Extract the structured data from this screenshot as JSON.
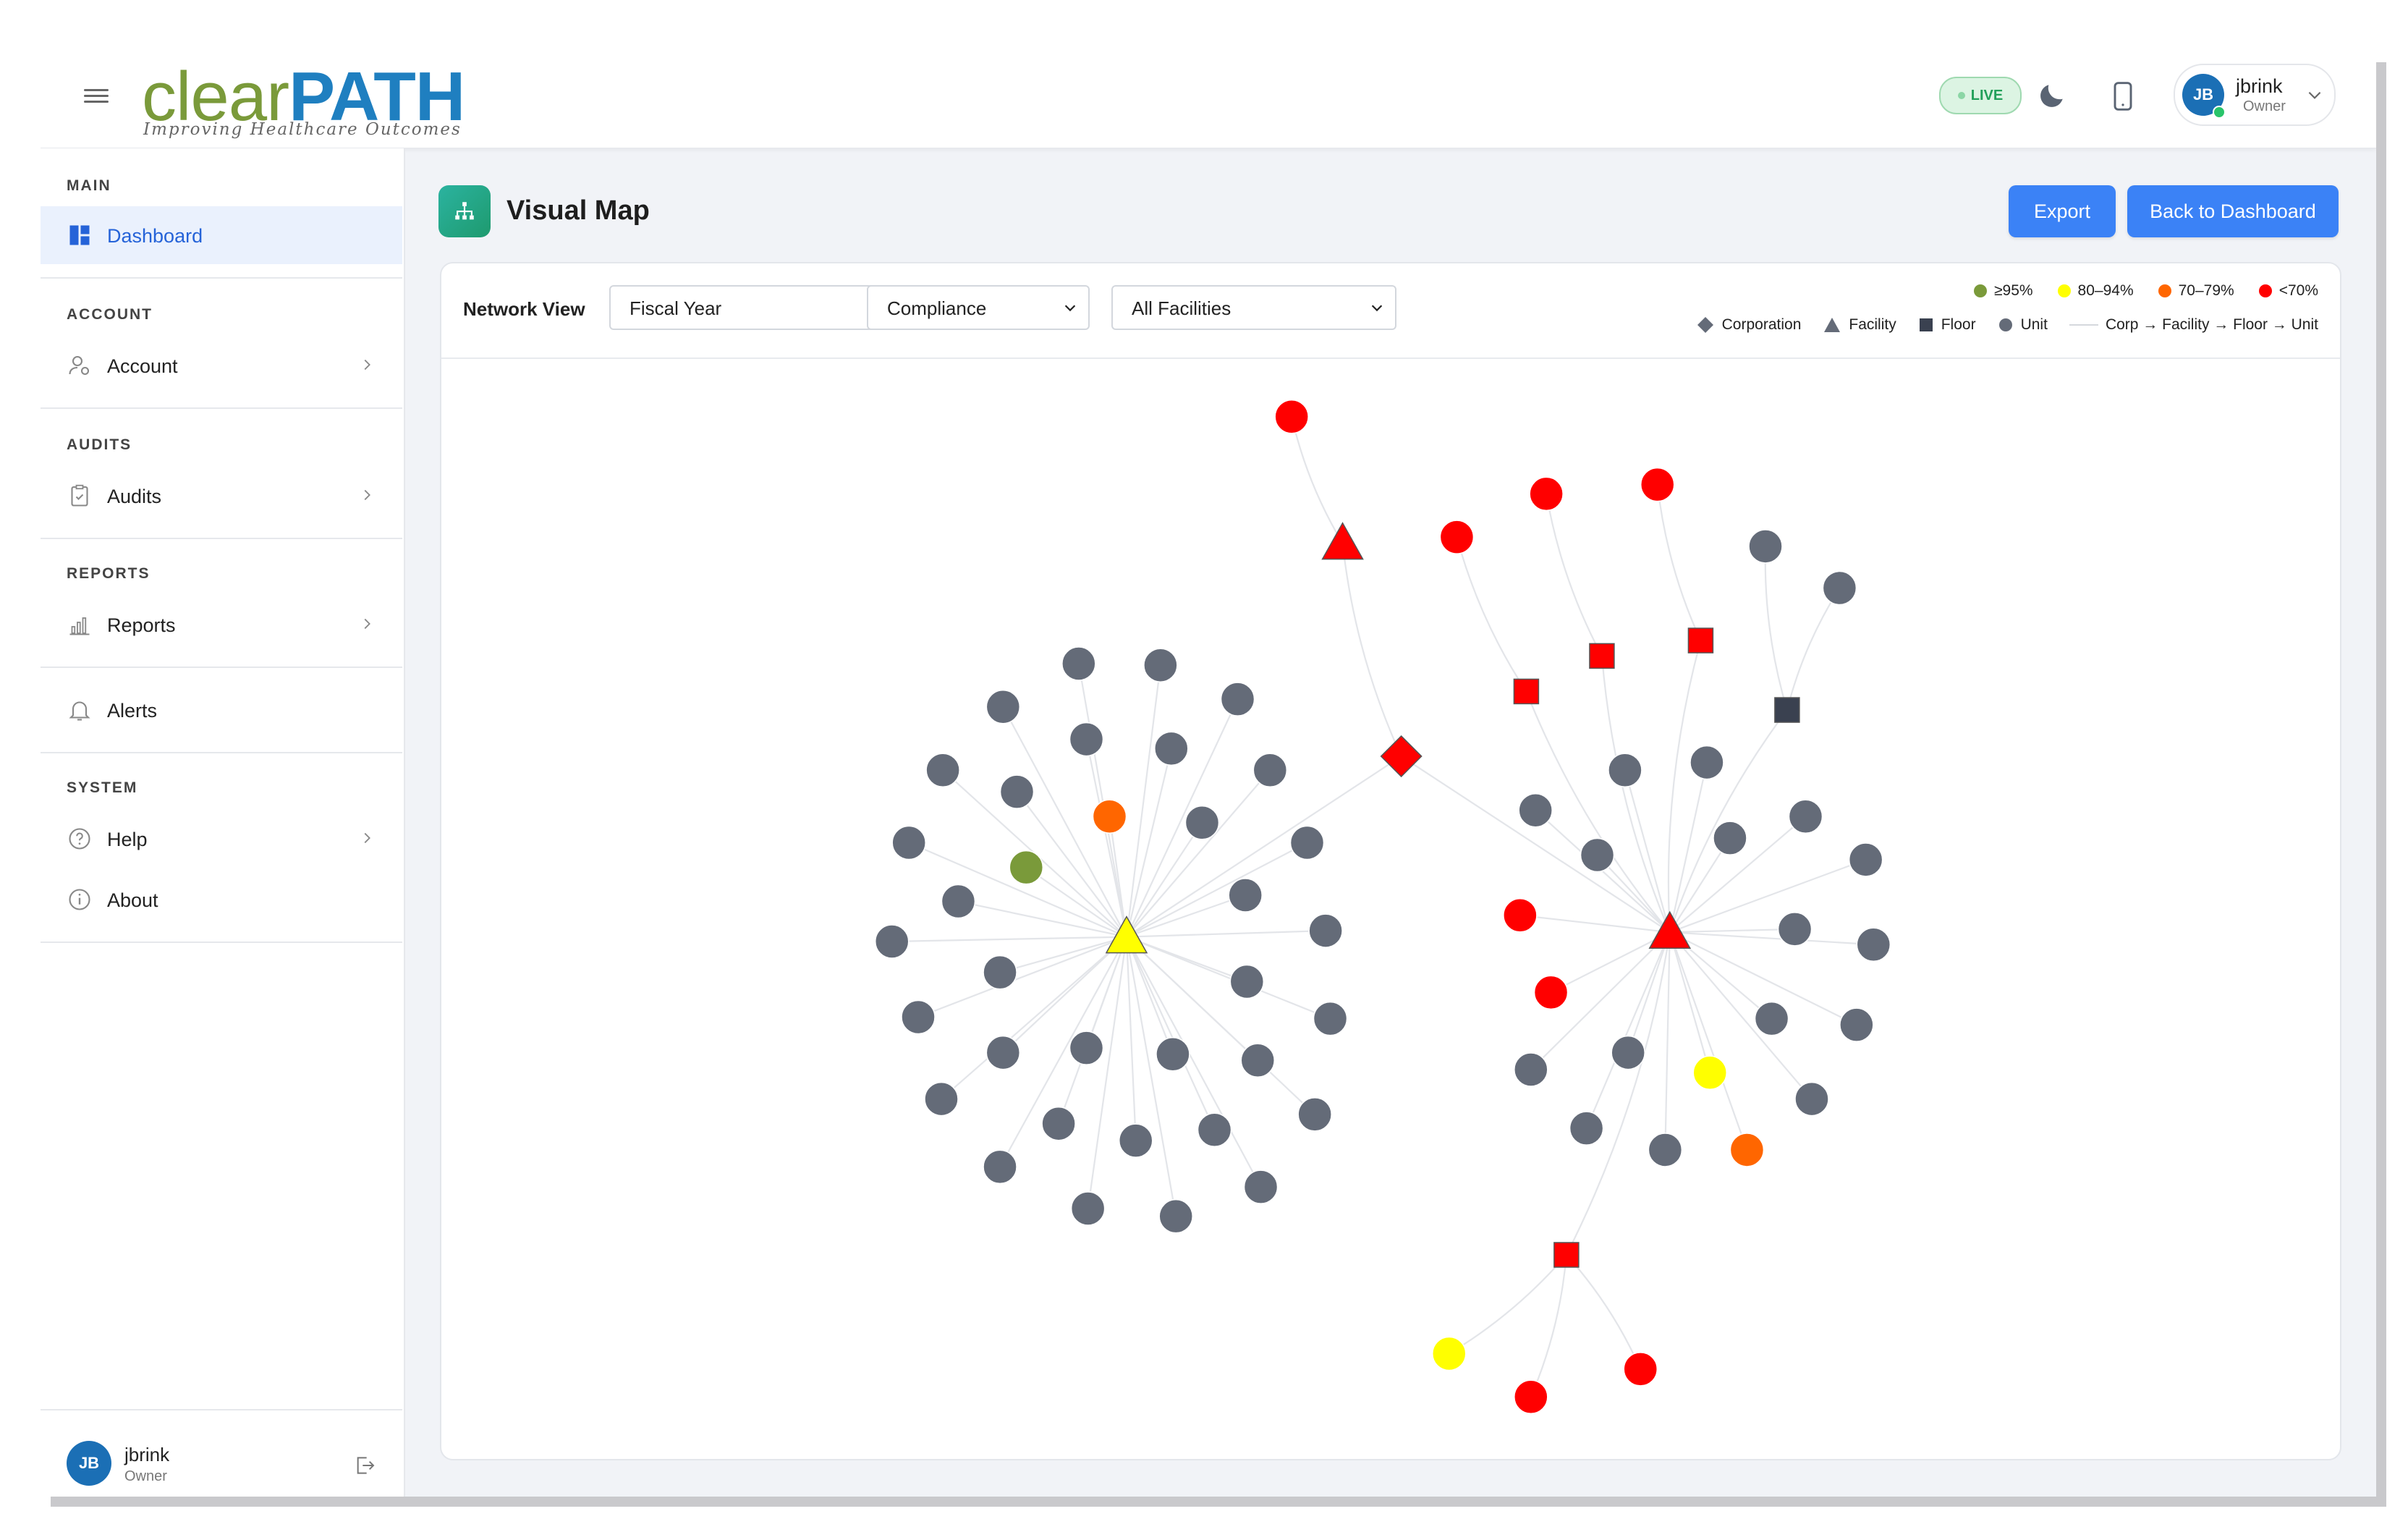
{
  "app": {
    "logo_word_a": "clear",
    "logo_word_b": "PATH",
    "logo_tagline": "Improving Healthcare Outcomes",
    "live_label": "LIVE",
    "user": {
      "initials": "JB",
      "name": "jbrink",
      "role": "Owner"
    }
  },
  "sidebar": {
    "sections": {
      "main": "MAIN",
      "account": "ACCOUNT",
      "audits": "AUDITS",
      "reports": "REPORTS",
      "system": "SYSTEM"
    },
    "items": {
      "dashboard": "Dashboard",
      "account": "Account",
      "audits": "Audits",
      "reports": "Reports",
      "alerts": "Alerts",
      "help": "Help",
      "about": "About"
    }
  },
  "page": {
    "title": "Visual Map",
    "export_label": "Export",
    "back_label": "Back to Dashboard"
  },
  "toolbar": {
    "network_label": "Network View",
    "period_selected": "Fiscal Year",
    "metric_selected": "Compliance",
    "facility_selected": "All Facilities"
  },
  "legend": {
    "colors": [
      {
        "label": "≥95%",
        "color": "#7a9a3a"
      },
      {
        "label": "80–94%",
        "color": "#ffff00"
      },
      {
        "label": "70–79%",
        "color": "#ff6600"
      },
      {
        "label": "<70%",
        "color": "#ff0000"
      }
    ],
    "shapes": {
      "corporation": "Corporation",
      "facility": "Facility",
      "floor": "Floor",
      "unit": "Unit",
      "link": "Corp → Facility → Floor → Unit"
    },
    "unit_color": "#646b78",
    "floor_color": "#3a4150"
  }
}
